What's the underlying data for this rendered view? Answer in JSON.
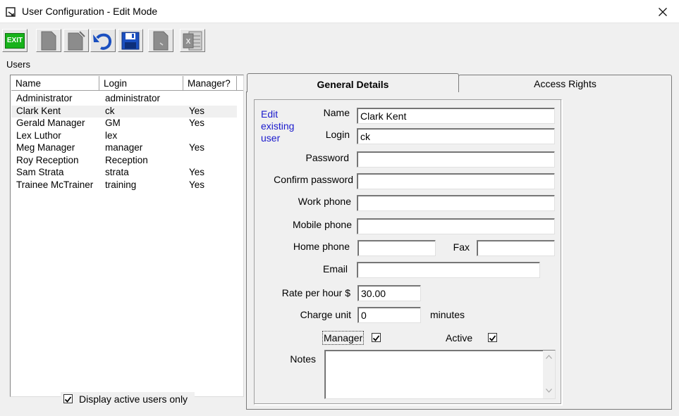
{
  "window": {
    "title": "User Configuration - Edit Mode"
  },
  "toolbar": {
    "exit_label": "EXIT",
    "excel_label": "X"
  },
  "users_panel": {
    "label": "Users",
    "columns": [
      "Name",
      "Login",
      "Manager?"
    ],
    "rows": [
      {
        "name": "Administrator",
        "login": "administrator",
        "manager": ""
      },
      {
        "name": "Clark Kent",
        "login": "ck",
        "manager": "Yes"
      },
      {
        "name": "Gerald Manager",
        "login": "GM",
        "manager": "Yes"
      },
      {
        "name": "Lex Luthor",
        "login": "lex",
        "manager": ""
      },
      {
        "name": "Meg Manager",
        "login": "manager",
        "manager": "Yes"
      },
      {
        "name": "Roy Reception",
        "login": "Reception",
        "manager": ""
      },
      {
        "name": "Sam Strata",
        "login": "strata",
        "manager": "Yes"
      },
      {
        "name": "Trainee McTrainer",
        "login": "training",
        "manager": "Yes"
      }
    ],
    "selected_index": 1,
    "display_active_label": "Display active users only",
    "display_active_checked": true
  },
  "tabs": {
    "general": "General Details",
    "access": "Access Rights"
  },
  "form": {
    "mode_note": "Edit existing user",
    "name_label": "Name",
    "name_value": "Clark Kent",
    "login_label": "Login",
    "login_value": "ck",
    "password_label": "Password",
    "password_value": "",
    "confirm_label": "Confirm password",
    "confirm_value": "",
    "work_phone_label": "Work phone",
    "work_phone_value": "",
    "mobile_label": "Mobile phone",
    "mobile_value": "",
    "home_phone_label": "Home phone",
    "home_phone_value": "",
    "fax_label": "Fax",
    "fax_value": "",
    "email_label": "Email",
    "email_value": "",
    "rate_label": "Rate per hour $",
    "rate_value": "30.00",
    "charge_label": "Charge unit",
    "charge_value": "0",
    "minutes_label": "minutes",
    "manager_label": "Manager",
    "manager_checked": true,
    "active_label": "Active",
    "active_checked": true,
    "notes_label": "Notes",
    "notes_value": ""
  },
  "colors": {
    "mode_note": "#1a1acc",
    "exit_green": "#17b21a",
    "save_blue": "#1a4fc0"
  }
}
